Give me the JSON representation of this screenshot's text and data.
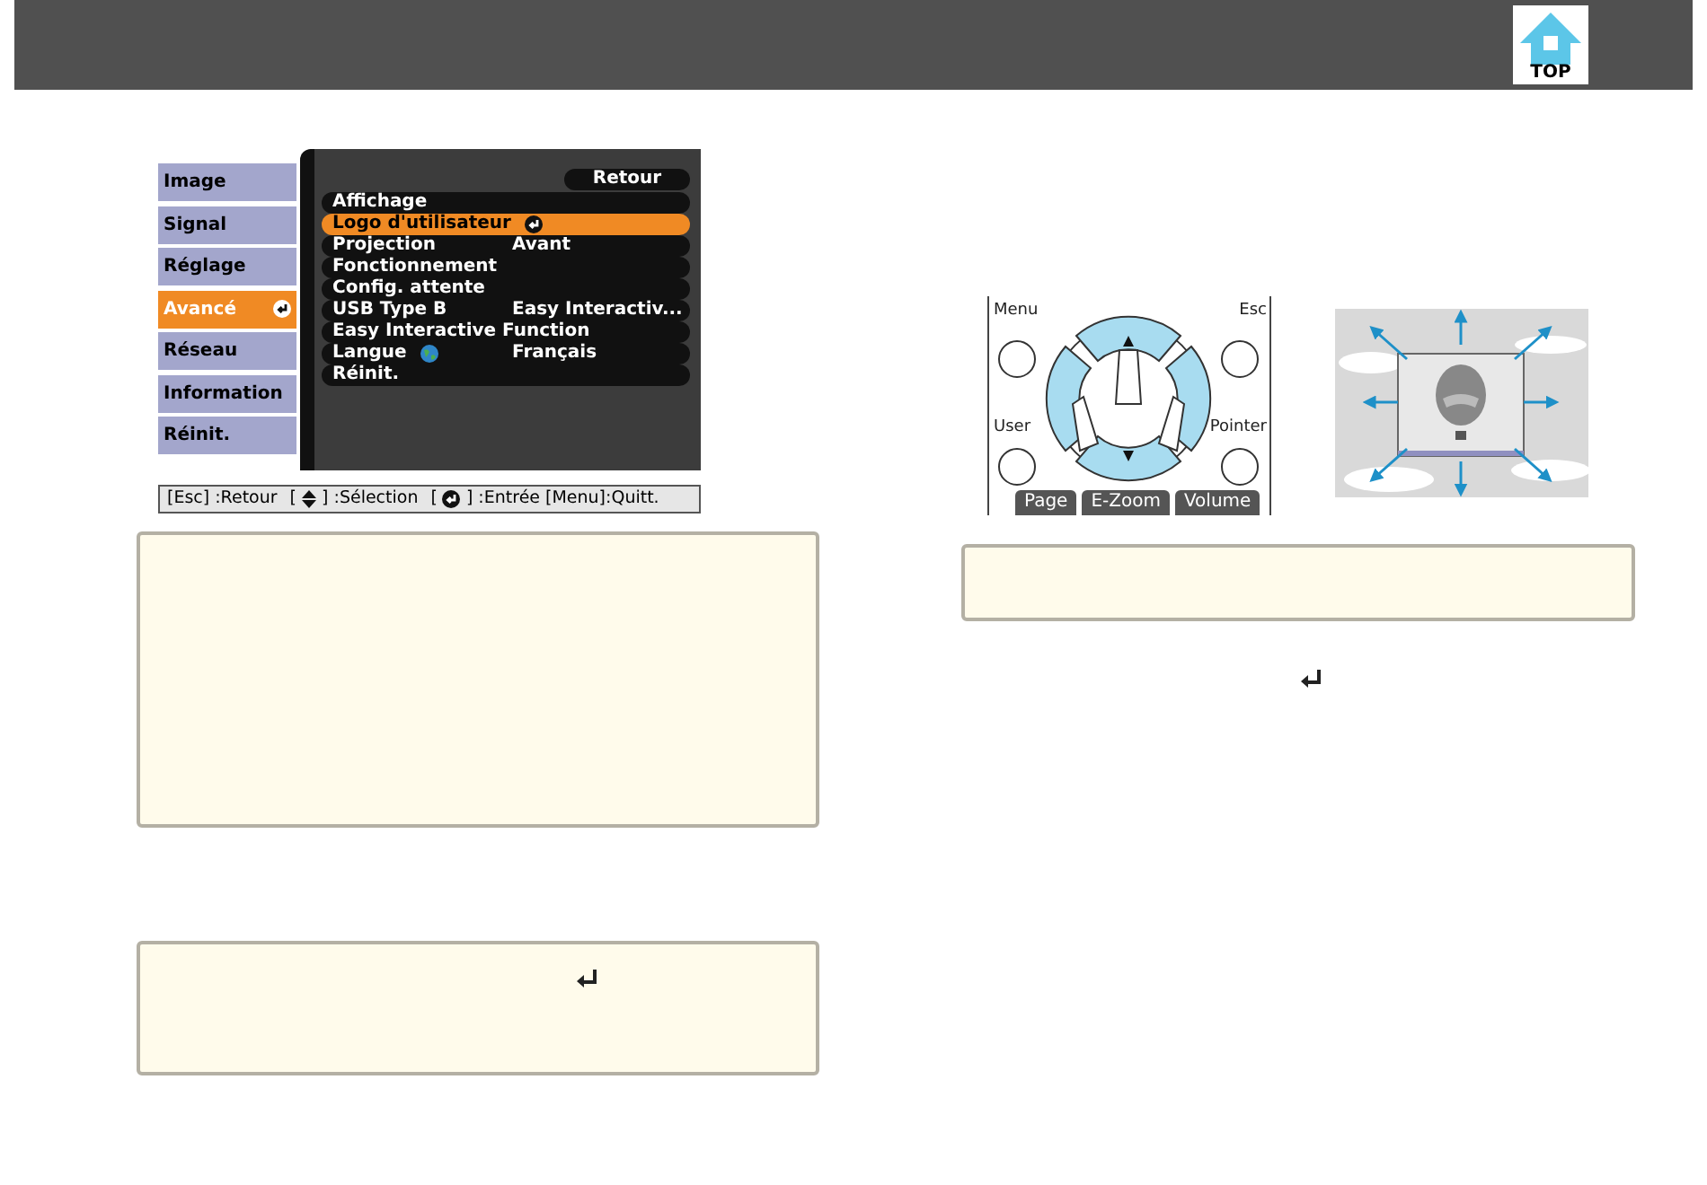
{
  "header": {
    "top_button": "TOP"
  },
  "osd_menu": {
    "tabs": [
      {
        "label": "Image",
        "selected": false
      },
      {
        "label": "Signal",
        "selected": false
      },
      {
        "label": "Réglage",
        "selected": false
      },
      {
        "label": "Avancé",
        "selected": true
      },
      {
        "label": "Réseau",
        "selected": false
      },
      {
        "label": "Information",
        "selected": false
      },
      {
        "label": "Réinit.",
        "selected": false
      }
    ],
    "back_button": "Retour",
    "items": [
      {
        "label": "Affichage",
        "selected": false
      },
      {
        "label": "Logo d'utilisateur",
        "selected": true
      },
      {
        "label": "Projection",
        "value": "Avant",
        "selected": false
      },
      {
        "label": "Fonctionnement",
        "selected": false
      },
      {
        "label": "Config. attente",
        "selected": false
      },
      {
        "label": "USB Type B",
        "value": "Easy Interactiv...",
        "selected": false
      },
      {
        "label": "Easy Interactive Function",
        "selected": false
      },
      {
        "label": "Langue",
        "value": "Français",
        "selected": false,
        "globe": true
      },
      {
        "label": "Réinit.",
        "selected": false
      }
    ],
    "hint": [
      {
        "kind": "text",
        "text": "[Esc] :Retour"
      },
      {
        "kind": "text",
        "text": "["
      },
      {
        "kind": "updown"
      },
      {
        "kind": "text",
        "text": "] :Sélection"
      },
      {
        "kind": "text",
        "text": "["
      },
      {
        "kind": "enter"
      },
      {
        "kind": "text",
        "text": "] :Entrée"
      },
      {
        "kind": "text",
        "text": "[Menu]:Quitt."
      }
    ]
  },
  "remote": {
    "buttons": [
      "Menu",
      "Esc",
      "User",
      "Pointer"
    ],
    "tabs": [
      "Page",
      "E-Zoom",
      "Volume"
    ]
  }
}
